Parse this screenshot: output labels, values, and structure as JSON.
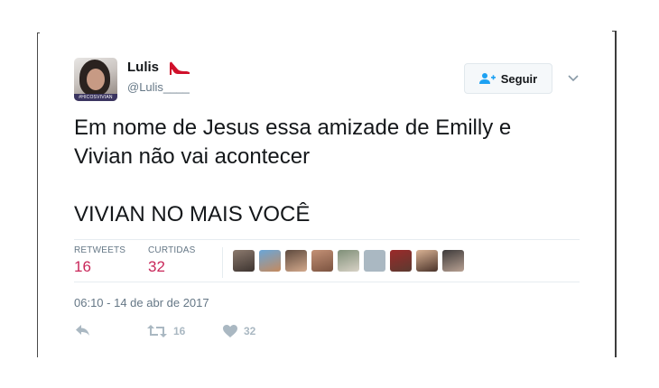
{
  "user": {
    "display_name": "Lulis",
    "handle": "@Lulis____",
    "avatar_caption": "#HICOSVIVIAN",
    "name_emoji": "high-heel-icon"
  },
  "follow_button": {
    "label": "Seguir",
    "icon": "user-plus-icon"
  },
  "tweet": {
    "lines": [
      "Em nome de Jesus essa amizade de Emilly e",
      "Vivian não vai acontecer",
      "VIVIAN NO MAIS VOCÊ"
    ]
  },
  "stats": {
    "retweets_label": "RETWEETS",
    "retweets_count": "16",
    "likes_label": "CURTIDAS",
    "likes_count": "32"
  },
  "likers_count_shown": 9,
  "timestamp": "06:10 - 14 de abr de 2017",
  "actions": {
    "reply_icon": "reply-icon",
    "retweet_icon": "retweet-icon",
    "retweet_count": "16",
    "like_icon": "heart-icon",
    "like_count": "32"
  },
  "colors": {
    "stat_count": "#c9275a",
    "muted_text": "#657786",
    "action_gray": "#aab8c2",
    "follow_icon": "#1da1f2",
    "heel_red": "#d0102b"
  }
}
